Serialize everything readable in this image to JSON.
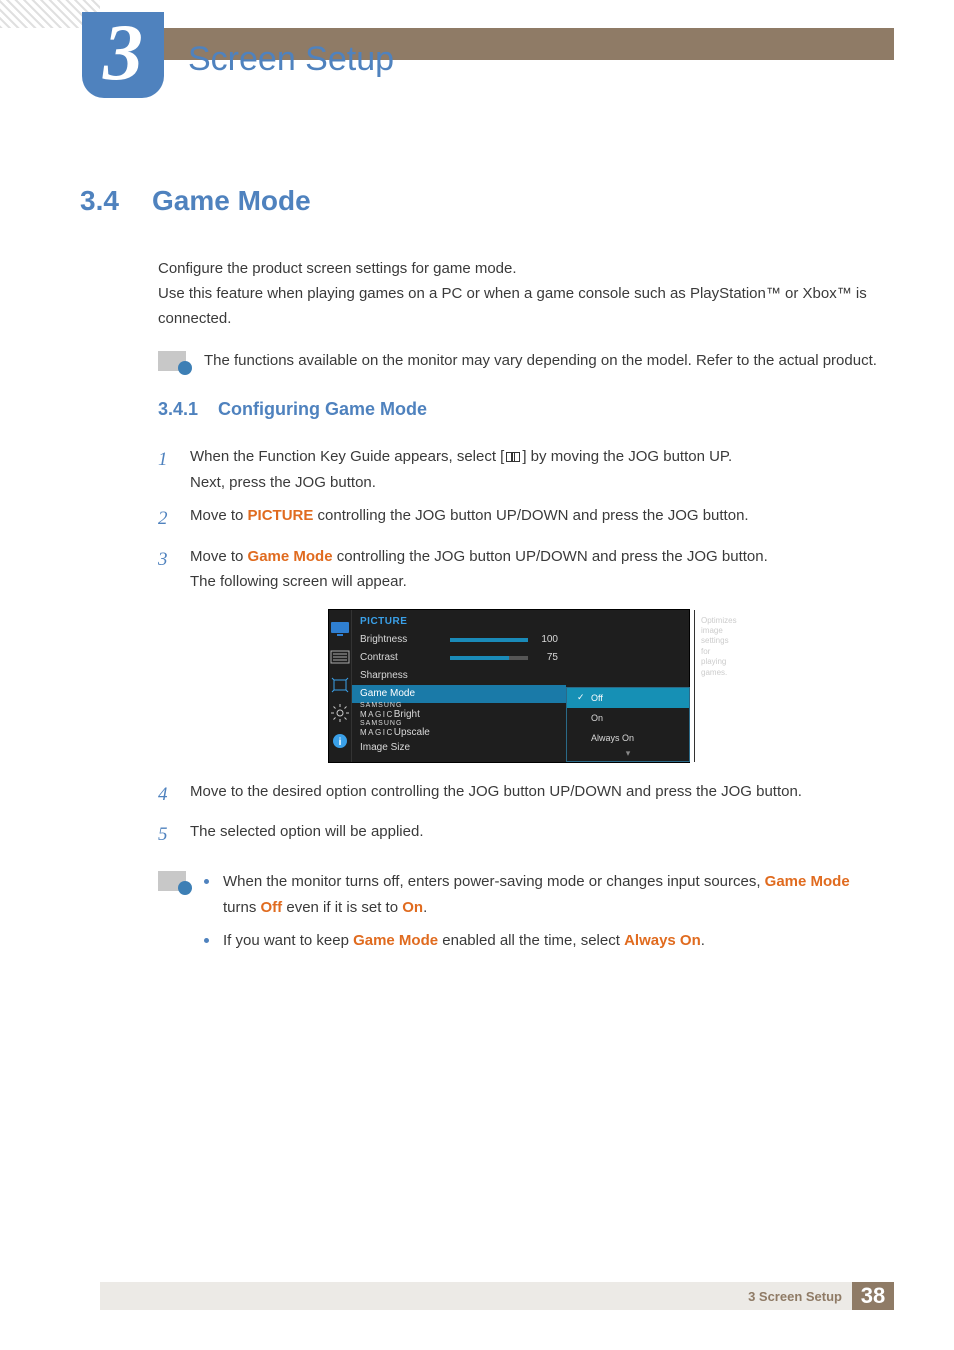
{
  "chapter": {
    "number": "3",
    "title": "Screen Setup"
  },
  "section": {
    "number": "3.4",
    "title": "Game Mode"
  },
  "intro": {
    "p1": "Configure the product screen settings for game mode.",
    "p2": "Use this feature when playing games on a PC or when a game console such as PlayStation™ or Xbox™ is connected."
  },
  "note1": "The functions available on the monitor may vary depending on the model. Refer to the actual product.",
  "subsection": {
    "number": "3.4.1",
    "title": "Configuring Game Mode"
  },
  "steps": {
    "s1a": "When the Function Key Guide appears, select [",
    "s1b": "] by moving the JOG button UP.",
    "s1c": "Next, press the JOG button.",
    "s2a": "Move to ",
    "s2kw": "PICTURE",
    "s2b": " controlling the JOG button UP/DOWN and press the JOG button.",
    "s3a": "Move to ",
    "s3kw": "Game Mode",
    "s3b": " controlling the JOG button UP/DOWN and press the JOG button.",
    "s3c": "The following screen will appear.",
    "s4": "Move to the desired option controlling the JOG button UP/DOWN and press the JOG button.",
    "s5": "The selected option will be applied."
  },
  "step_numbers": {
    "n1": "1",
    "n2": "2",
    "n3": "3",
    "n4": "4",
    "n5": "5"
  },
  "osd": {
    "header": "PICTURE",
    "items": {
      "brightness": "Brightness",
      "contrast": "Contrast",
      "sharpness": "Sharpness",
      "game_mode": "Game Mode",
      "magic_prefix": "SAMSUNG",
      "magic_word": "MAGIC",
      "magic_bright": "Bright",
      "magic_upscale": "Upscale",
      "image_size": "Image Size"
    },
    "values": {
      "brightness": "100",
      "contrast": "75"
    },
    "slider": {
      "brightness_pct": 100,
      "contrast_pct": 75
    },
    "options": {
      "off": "Off",
      "on": "On",
      "always_on": "Always On"
    },
    "help": "Optimizes image settings for playing games."
  },
  "note2": {
    "b1a": "When the monitor turns off, enters power-saving mode or changes input sources, ",
    "b1kw1": "Game Mode",
    "b1b": " turns ",
    "b1kw2": "Off",
    "b1c": " even if it is set to ",
    "b1kw3": "On",
    "b1d": ".",
    "b2a": "If you want to keep ",
    "b2kw1": "Game Mode",
    "b2b": " enabled all the time, select ",
    "b2kw2": "Always On",
    "b2c": "."
  },
  "footer": {
    "label": "3 Screen Setup",
    "page": "38"
  }
}
